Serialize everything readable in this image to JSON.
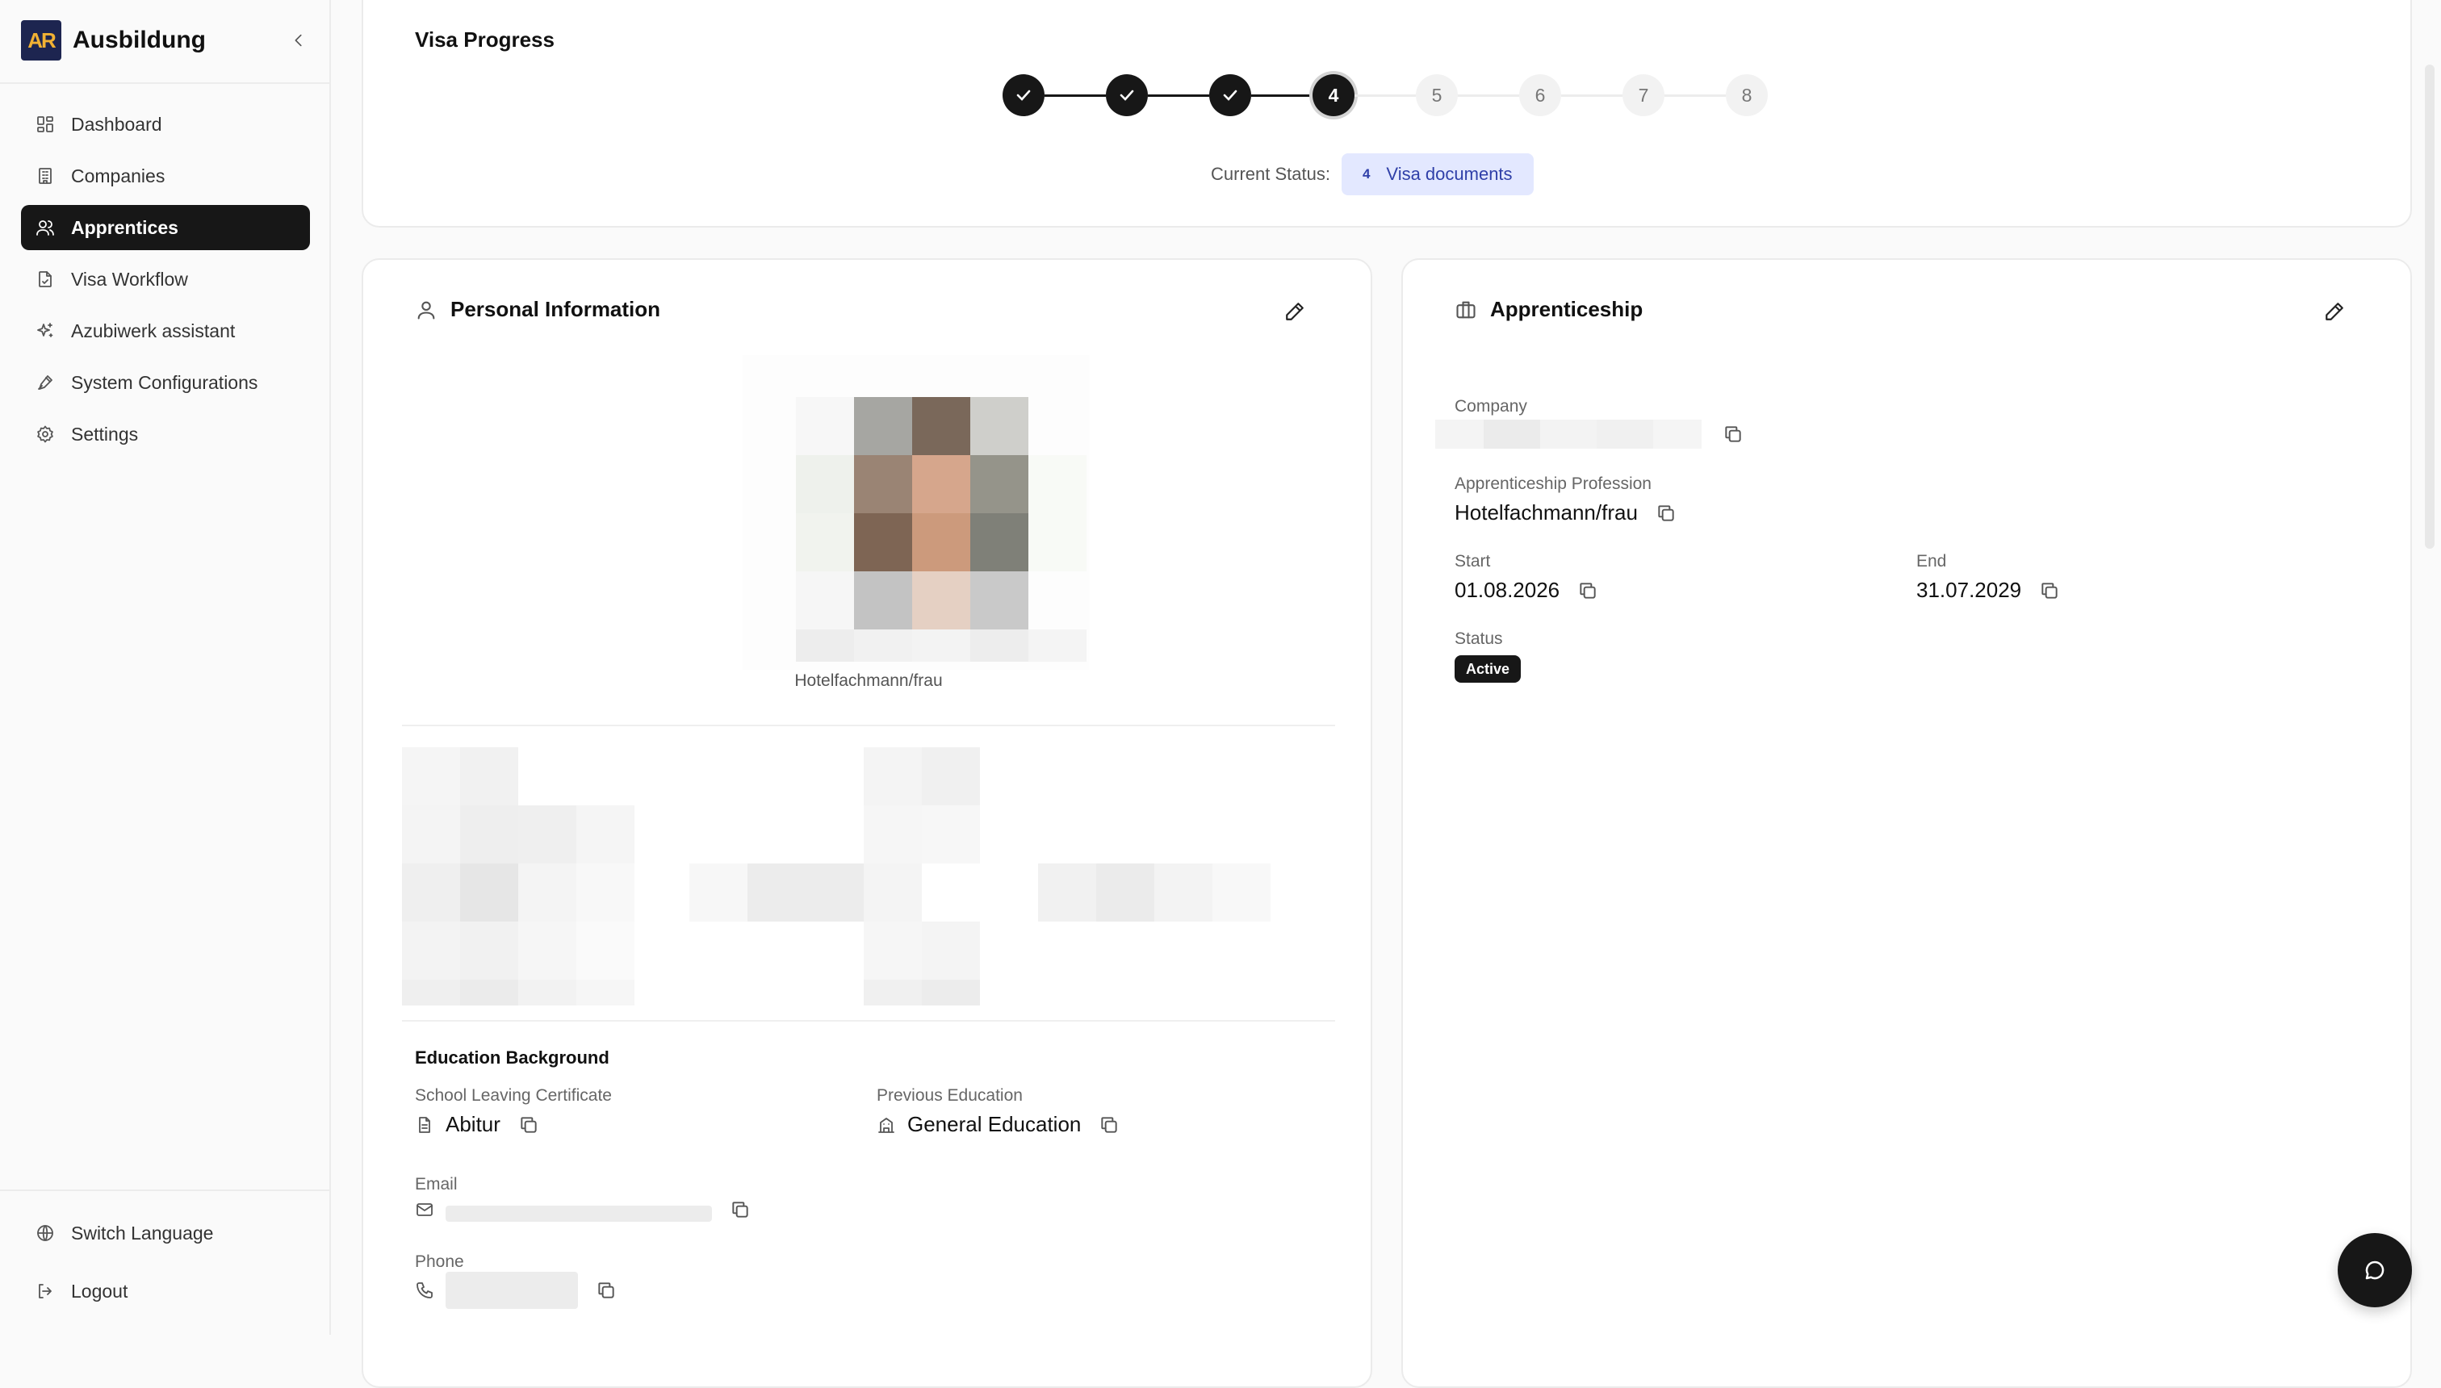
{
  "sidebar": {
    "brand": "Ausbildung",
    "logo_text": "AR",
    "nav": [
      {
        "label": "Dashboard",
        "icon": "dashboard-icon"
      },
      {
        "label": "Companies",
        "icon": "building-icon"
      },
      {
        "label": "Apprentices",
        "icon": "users-icon",
        "active": true
      },
      {
        "label": "Visa Workflow",
        "icon": "file-check-icon"
      },
      {
        "label": "Azubiwerk assistant",
        "icon": "sparkles-icon"
      },
      {
        "label": "System Configurations",
        "icon": "pen-tool-icon"
      },
      {
        "label": "Settings",
        "icon": "gear-icon"
      }
    ],
    "bottom": [
      {
        "label": "Switch Language",
        "icon": "globe-icon"
      },
      {
        "label": "Logout",
        "icon": "logout-icon"
      }
    ]
  },
  "visa": {
    "title": "Visa Progress",
    "steps": [
      "done",
      "done",
      "done",
      "4",
      "5",
      "6",
      "7",
      "8"
    ],
    "current_status_label": "Current Status:",
    "current_step": "4",
    "current_status": "Visa documents"
  },
  "personal": {
    "title": "Personal Information",
    "photo_caption": "Hotelfachmann/frau",
    "education_heading": "Education Background",
    "school_label": "School Leaving Certificate",
    "school_value": "Abitur",
    "prev_edu_label": "Previous Education",
    "prev_edu_value": "General Education",
    "email_label": "Email",
    "phone_label": "Phone"
  },
  "apprenticeship": {
    "title": "Apprenticeship",
    "company_label": "Company",
    "profession_label": "Apprenticeship Profession",
    "profession_value": "Hotelfachmann/frau",
    "start_label": "Start",
    "start_value": "01.08.2026",
    "end_label": "End",
    "end_value": "31.07.2029",
    "status_label": "Status",
    "status_value": "Active"
  },
  "colors": {
    "primary": "#171717",
    "status_pill_bg": "#e3e8ff",
    "status_pill_text": "#2f3fa8"
  }
}
